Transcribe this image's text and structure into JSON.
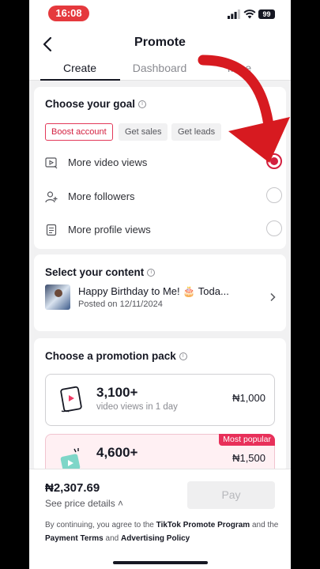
{
  "status_bar": {
    "time": "16:08",
    "battery": "99"
  },
  "header": {
    "title": "Promote",
    "tabs": [
      "Create",
      "Dashboard",
      "Mine"
    ]
  },
  "goal": {
    "title": "Choose your goal",
    "tabs": [
      "Boost account",
      "Get sales",
      "Get leads"
    ],
    "options": [
      {
        "label": "More video views",
        "icon": "video-play-icon",
        "selected": true
      },
      {
        "label": "More followers",
        "icon": "add-user-icon",
        "selected": false
      },
      {
        "label": "More profile views",
        "icon": "profile-doc-icon",
        "selected": false
      }
    ]
  },
  "content": {
    "title": "Select your content",
    "video_title": "Happy Birthday to Me! 🎂 Toda...",
    "posted": "Posted on 12/11/2024"
  },
  "packs": {
    "title": "Choose a promotion pack",
    "items": [
      {
        "number": "3,100+",
        "desc": "video views in 1 day",
        "price": "₦1,000"
      },
      {
        "number": "4,600+",
        "badge": "Most popular",
        "price": "₦1,500"
      }
    ]
  },
  "footer": {
    "total": "₦2,307.69",
    "details": "See price details",
    "pay": "Pay",
    "legal_prefix": "By continuing, you agree to the ",
    "legal_link1": "TikTok Promote Program",
    "legal_and1": " and the ",
    "legal_link2": "Payment Terms",
    "legal_and2": " and ",
    "legal_link3": "Advertising Policy"
  },
  "colors": {
    "accent": "#d31f3f",
    "badge": "#e8305a",
    "status_pill": "#e5393d",
    "overlay_arrow": "#d71a20"
  }
}
